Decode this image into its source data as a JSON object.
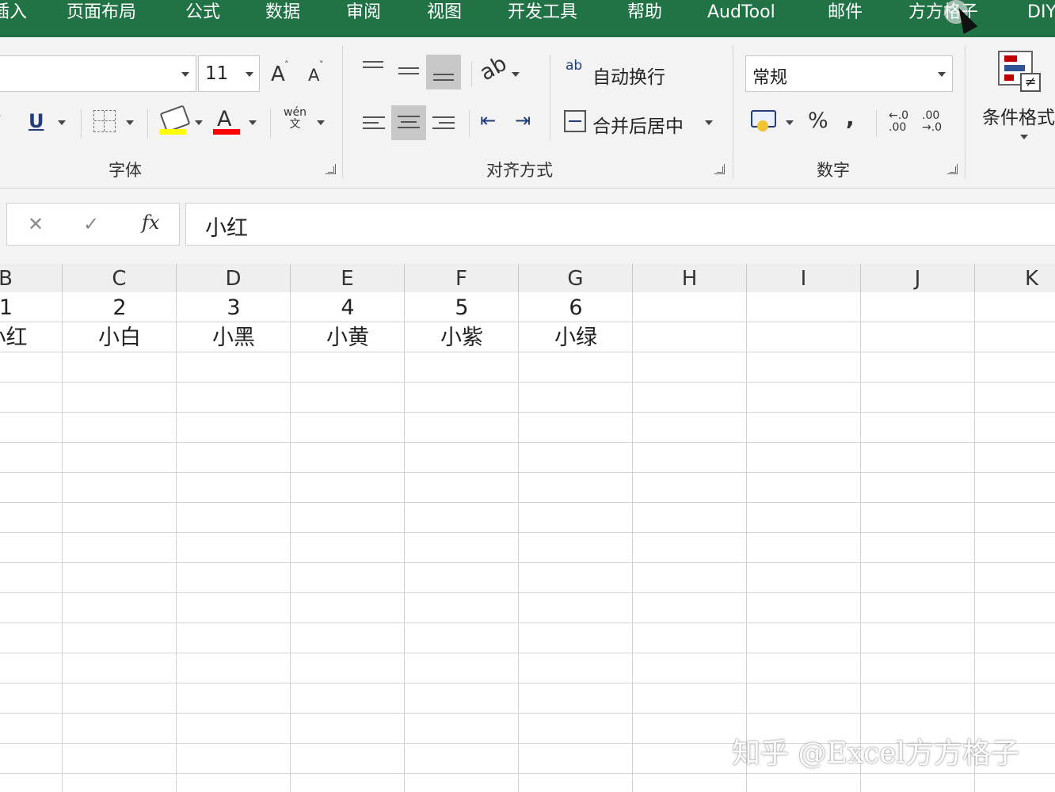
{
  "tabs": [
    "插入",
    "页面布局",
    "公式",
    "数据",
    "审阅",
    "视图",
    "开发工具",
    "帮助",
    "AudTool",
    "邮件",
    "方方格子",
    "DIY"
  ],
  "font_group": {
    "font_name": "",
    "font_size": "11",
    "grow_icon": "A",
    "shrink_icon": "A",
    "partial_letter": "I",
    "underline": "U",
    "font_color_letter": "A",
    "phonetic": "wén\n文",
    "label": "字体",
    "fill_color": "#ffff00",
    "font_color": "#ff0000"
  },
  "alignment_group": {
    "wrap_text_icon": "ab",
    "wrap_text": "自动换行",
    "merge_center": "合并后居中",
    "label": "对齐方式"
  },
  "number_group": {
    "format": "常规",
    "percent": "%",
    "comma": ",",
    "inc_decimal": "←.0 .00",
    "dec_decimal": ".00 →.0",
    "label": "数字"
  },
  "styles_group": {
    "conditional_format": "条件格式"
  },
  "formula_bar": {
    "cancel": "✕",
    "enter": "✓",
    "fx": "fx",
    "value": "小红"
  },
  "columns": [
    "B",
    "C",
    "D",
    "E",
    "F",
    "G",
    "H",
    "I",
    "J",
    "K"
  ],
  "rows": [
    [
      "1",
      "2",
      "3",
      "4",
      "5",
      "6",
      "",
      "",
      "",
      ""
    ],
    [
      "小红",
      "小白",
      "小黑",
      "小黄",
      "小紫",
      "小绿",
      "",
      "",
      "",
      ""
    ]
  ],
  "watermark": "知乎 @Excel方方格子",
  "colors": {
    "ribbon_tab_bg": "#217346",
    "ribbon_bg": "#f3f3f3"
  }
}
